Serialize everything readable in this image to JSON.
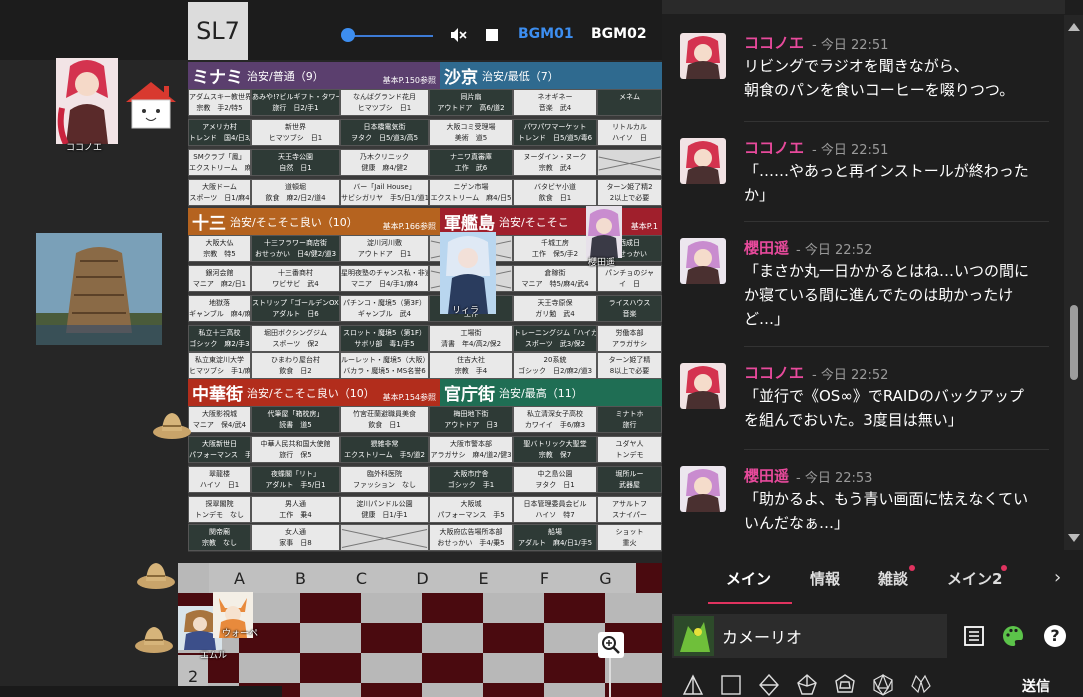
{
  "scene": {
    "level_badge": "SL7",
    "bgm_tabs": [
      "BGM01",
      "BGM02"
    ],
    "volume_fraction": 0.05
  },
  "districts": [
    {
      "name": "ミナミ",
      "security": "治安/普通（9）",
      "ref": "基本P.150参照"
    },
    {
      "name": "沙京",
      "security": "治安/最低（7）",
      "ref": ""
    },
    {
      "name": "十三",
      "security": "治安/そこそこ良い（10）",
      "ref": "基本P.166参照"
    },
    {
      "name": "軍艦島",
      "security": "治安/そこそこ",
      "ref": "基本P.1"
    },
    {
      "name": "中華街",
      "security": "治安/そこそこ良い（10）",
      "ref": "基本P.154参照"
    },
    {
      "name": "官庁街",
      "security": "治安/最高（11）",
      "ref": ""
    }
  ],
  "map_cells": [
    [
      "アダムスキー教世界大神殿\n宗教　手2/特5",
      "あみや!?ビルギフト・タワー\n旅行　日2/手1",
      "なんばグランド花月\nヒマツブシ　日1",
      "同片扇\nアウトドア　高6/道2",
      "ネオギネー\n音楽　武4",
      "メネム"
    ],
    [
      "アメリカ村\nトレンド　国4/日3/道2",
      "新世界\nヒマツブシ　日1",
      "日本橋電気街\nヲタク　日5/道3/高5",
      "大阪コミ受理場\n美術　道5",
      "パワパワマーケット\nトレンド　日5/道5/毒6",
      "リトルカル\nハイソ　日"
    ],
    [
      "SMクラブ「鳳」\nエクストリーム　麻4/日3/道4",
      "天王寺公園\n自然　日1",
      "乃木クリニック\n健康　麻4/健2",
      "ナニワ真審庫\n工作　武6",
      "ヌーダイン・ヌーク\n宗教　武4",
      ""
    ],
    [
      "大阪ドーム\nスポーツ　日1/麻4",
      "道頓堀\n飲食　麻2/日2/道4",
      "バー「Jail House」\nサビシガリヤ　手5/日1/道1",
      "ニゲン市場\nエクストリーム　麻4/日5",
      "バタビヤ小道\n飲食　日1",
      "ターン姫了精2\n2以上で必要"
    ],
    [
      "大阪大仏\n宗教　特5",
      "十三フラワー商店街\nおせっかい　日4/健2/道3",
      "淀川河川敷\nアウトドア　日1",
      "",
      "千城工房\n工作　保5/手2",
      "西成日\nおせっかい"
    ],
    [
      "銀河会館\nマニア　麻2/日1",
      "十三番商村\nワビサビ　武4",
      "星明夜塾のチャンス私・非道\nマニア　日4/手1/麻4",
      "",
      "倉稼街\nマニア　特5/麻4/武4",
      "パンチョのジャ\nイ　日"
    ],
    [
      "地獄落\nギャンブル　麻4/麻4",
      "ストリップ「ゴールデンOX」\nアダルト　日6",
      "パチンコ・魔境5（第3F）\nギャンブル　武4",
      "グ\n工作",
      "天王寺原保\nガリ勉　武4",
      "ライスハウス\n音楽"
    ],
    [
      "私立十三高校\nゴシック　麻2/手3",
      "堀田ボクシングジム\nスポーツ　保2",
      "スロット・魔境5（第1F）\nサボリ部　毒1/手5",
      "工場街\n清書　年4/高2/保2",
      "トレーニングジム「ハイカル」\nスポーツ　武3/保2",
      "労働本部\nアラガサシ"
    ],
    [
      "私立東淀川大学\nヒマツブシ　手1/麻1/麻4",
      "ひまわり屋台村\n飲食　日2",
      "ルーレット・魔境5（大阪）\nバカラ・魔境5・MS名誉6",
      "住吉大社\n宗教　手4",
      "20系統\nゴシック　日2/麻2/道3",
      "ターン姫了精\n8以上で必要"
    ],
    [
      "大阪影視城\nマニア　保4/武4",
      "代筆屋「箱枕房」\n読書　道5",
      "竹宮荘蘭避職員美食\n飲食　日1",
      "梅田地下街\nアウトドア　日3",
      "私立清深女子高校\nカワイイ　手6/麻3",
      "ミナトホ\n旅行"
    ],
    [
      "大阪新世日\nパフォーマンス　手2/武5",
      "中華人民共和国大使館\n旅行　保5",
      "猥雑非常\nエクストリーム　手5/道2",
      "大阪市警本部\nアラガサシ　麻4/道2/健3",
      "聖バトリック大聖堂\n宗教　保7",
      "ユダヤ人\nトンデモ"
    ],
    [
      "翠龍楼\nハイソ　日1",
      "夜蝶閣「リト」\nアダルト　手5/日1",
      "臨外科医院\nファッション　なし",
      "大阪市庁舎\nゴシック　手1",
      "中之島公園\nヲタク　日1",
      "堀所ルー\n武器屋"
    ],
    [
      "探翠閣院\nトンデモ　なし",
      "男人通\n工作　乗4",
      "淀川パンドル公園\n健康　日1/手1",
      "大阪城\nパフォーマンス　手5",
      "日本管理委員会ビル\nハイソ　特7",
      "アサルトフ\nスナイパー"
    ],
    [
      "関帝廟\n宗教　なし",
      "女人通\n家事　日8",
      "",
      "大阪府広告場所本部\nおせっかい　手4/乗5",
      "船場\nアダルト　麻4/日1/手5",
      "ショット\n重火"
    ]
  ],
  "tokens": [
    {
      "name": "ココノエ"
    },
    {
      "name": "リィラ"
    },
    {
      "name": "櫻田遥"
    },
    {
      "name": "エムル"
    },
    {
      "name": "ウォーペ"
    }
  ],
  "board": {
    "columns": [
      "A",
      "B",
      "C",
      "D",
      "E",
      "F",
      "G"
    ],
    "rows": [
      "2"
    ]
  },
  "chat": {
    "messages": [
      {
        "name": "ココノエ",
        "time": "- 今日 22:51",
        "color": "#e84a9c",
        "text": "リビングでラジオを聞きながら、\n朝食のパンを食いコーヒーを啜りつつ。"
      },
      {
        "name": "ココノエ",
        "time": "- 今日 22:51",
        "color": "#e84a9c",
        "text": "「……やあっと再インストールが終わった\nか」"
      },
      {
        "name": "櫻田遥",
        "time": "- 今日 22:52",
        "color": "#e84a9c",
        "text": "「まさか丸一日かかるとはね…いつの間に\nか寝ている間に進んでたのは助かったけ\nど…」"
      },
      {
        "name": "ココノエ",
        "time": "- 今日 22:52",
        "color": "#e84a9c",
        "text": "「並行で《OS∞》でRAIDのバックアップ\nを組んでおいた。3度目は無い」"
      },
      {
        "name": "櫻田遥",
        "time": "- 今日 22:53",
        "color": "#e84a9c",
        "text": "「助かるよ、もう青い画面に怯えなくてい\nいんだなぁ…」"
      }
    ],
    "tabs": [
      "メイン",
      "情報",
      "雑談",
      "メイン2"
    ],
    "active_tab": "メイン",
    "character_name": "カメーリオ",
    "send_label": "送信"
  },
  "colors": {
    "accent": "#e0335f",
    "name_pink": "#e84a9c",
    "bgm_active": "#3d8ef0",
    "board_dark": "#4a0a0f",
    "board_light": "#b8b8b8"
  }
}
